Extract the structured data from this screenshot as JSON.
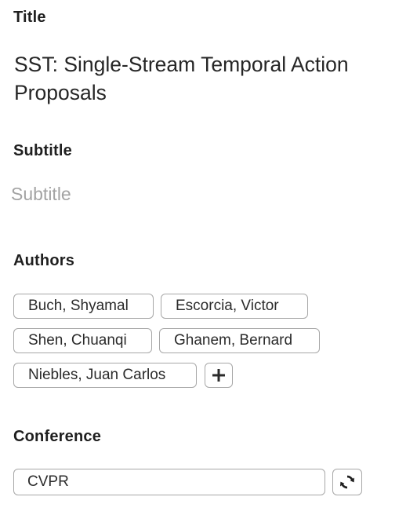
{
  "labels": {
    "title": "Title",
    "subtitle": "Subtitle",
    "authors": "Authors",
    "conference": "Conference"
  },
  "title_value": "SST: Single-Stream Temporal Action Proposals",
  "subtitle_placeholder": "Subtitle",
  "authors": [
    "Buch, Shyamal",
    "Escorcia, Victor",
    "Shen, Chuanqi",
    "Ghanem, Bernard",
    "Niebles, Juan Carlos"
  ],
  "conference_value": "CVPR",
  "icons": {
    "add_author": "plus-icon",
    "sync_conference": "sync-icon"
  }
}
